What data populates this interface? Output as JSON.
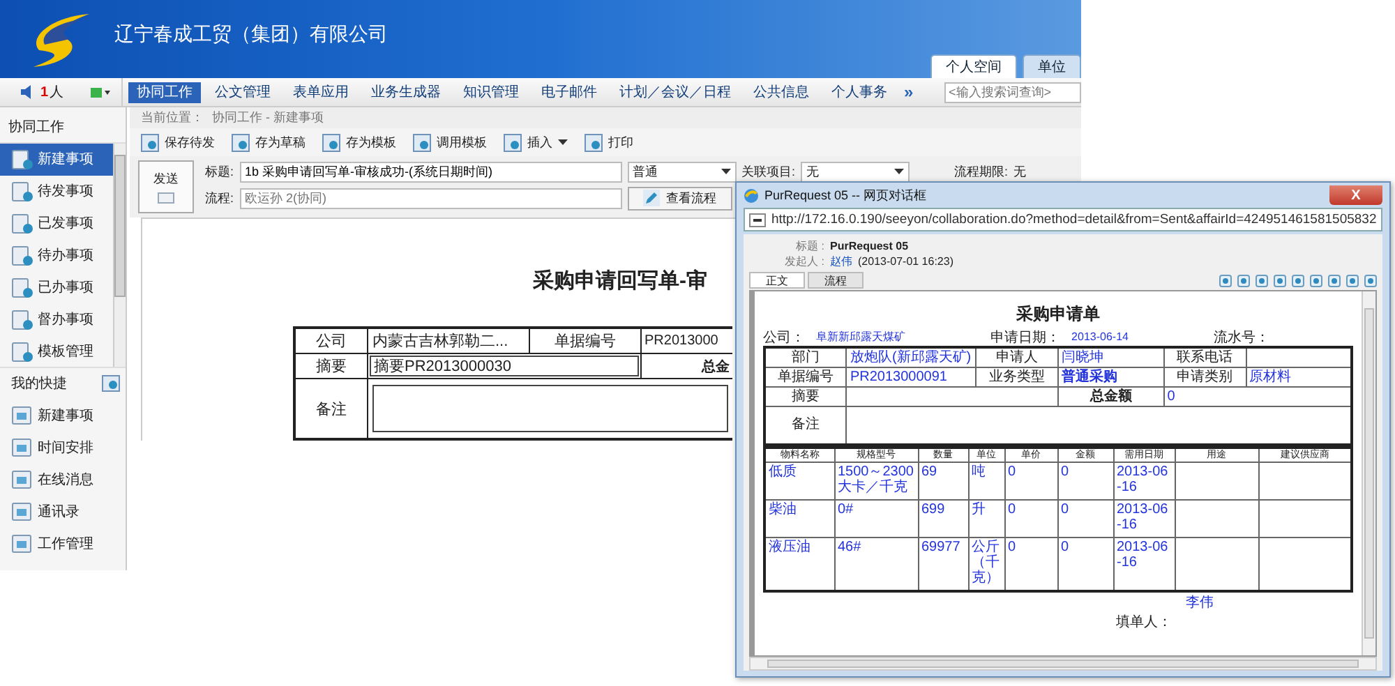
{
  "header": {
    "company": "辽宁春成工贸（集团）有限公司",
    "tabs": [
      {
        "label": "个人空间",
        "selected": true
      },
      {
        "label": "单位",
        "selected": false
      }
    ]
  },
  "nav": {
    "online_count": "1",
    "online_unit": "人",
    "more": "»",
    "search": {
      "placeholder": "<输入搜索词查询>"
    },
    "items": [
      {
        "label": "协同工作",
        "selected": true
      },
      {
        "label": "公文管理",
        "selected": false
      },
      {
        "label": "表单应用",
        "selected": false
      },
      {
        "label": "业务生成器",
        "selected": false
      },
      {
        "label": "知识管理",
        "selected": false
      },
      {
        "label": "电子邮件",
        "selected": false
      },
      {
        "label": "计划／会议／日程",
        "selected": false
      },
      {
        "label": "公共信息",
        "selected": false
      },
      {
        "label": "个人事务",
        "selected": false
      }
    ]
  },
  "sidebar": {
    "title": "协同工作",
    "shortcuts_title": "我的快捷",
    "items": [
      {
        "label": "新建事项",
        "selected": true
      },
      {
        "label": "待发事项",
        "selected": false
      },
      {
        "label": "已发事项",
        "selected": false
      },
      {
        "label": "待办事项",
        "selected": false
      },
      {
        "label": "已办事项",
        "selected": false
      },
      {
        "label": "督办事项",
        "selected": false
      },
      {
        "label": "模板管理",
        "selected": false
      }
    ],
    "shortcuts": [
      "新建事项",
      "时间安排",
      "在线消息",
      "通讯录",
      "工作管理"
    ]
  },
  "breadcrumb": {
    "label": "当前位置：",
    "path": "协同工作 - 新建事项"
  },
  "toolbar": [
    {
      "label": "保存待发",
      "dropdown": false
    },
    {
      "label": "存为草稿",
      "dropdown": false
    },
    {
      "label": "存为模板",
      "dropdown": false
    },
    {
      "label": "调用模板",
      "dropdown": false
    },
    {
      "label": "插入",
      "dropdown": true
    },
    {
      "label": "打印",
      "dropdown": false
    }
  ],
  "compose": {
    "send": "发送",
    "subject_label": "标题:",
    "subject": "1b 采购申请回写单-审核成功-(系统日期时间)",
    "priority": "普通",
    "related_label": "关联项目:",
    "related": "无",
    "deadline_label": "流程期限:",
    "deadline": "无",
    "flow_label": "流程:",
    "flow_placeholder": "欧运孙 2(协同)",
    "view_flow": "查看流程"
  },
  "document": {
    "title": "采购申请回写单-审",
    "company_label": "公司",
    "company": "内蒙古吉林郭勒二...",
    "number_label": "单据编号",
    "number": "PR2013000",
    "summary_label": "摘要",
    "summary": "摘要PR2013000030",
    "total_label": "总金",
    "remark_label": "备注"
  },
  "dialog": {
    "title": "PurRequest 05 -- 网页对话框",
    "close": "X",
    "url": "http://172.16.0.190/seeyon/collaboration.do?method=detail&from=Sent&affairId=424951461581505832",
    "subject_label": "标题 :",
    "subject": "PurRequest 05",
    "sender_label": "发起人 :",
    "sender": "赵伟",
    "sent_time": "(2013-07-01 16:23)",
    "tabs": [
      {
        "label": "正文",
        "selected": true
      },
      {
        "label": "流程",
        "selected": false
      }
    ],
    "form": {
      "title": "采购申请单",
      "company_label": "公司：",
      "company": "阜新新邱露天煤矿",
      "date_label": "申请日期：",
      "date": "2013-06-14",
      "serial_label": "流水号：",
      "dept_label": "部门",
      "dept": "放炮队(新邱露天矿)",
      "applicant_label": "申请人",
      "applicant": "闫晓坤",
      "phone_label": "联系电话",
      "number_label": "单据编号",
      "number": "PR2013000091",
      "biz_type_label": "业务类型",
      "biz_type": "普通采购",
      "category_label": "申请类别",
      "category": "原材料",
      "summary_label": "摘要",
      "total_label": "总金额",
      "total": "0",
      "remark_label": "备注",
      "columns": [
        "物料名称",
        "规格型号",
        "数量",
        "单位",
        "单价",
        "金额",
        "需用日期",
        "用途",
        "建议供应商"
      ],
      "rows": [
        [
          "低质",
          "1500～2300大卡／千克",
          "69",
          "吨",
          "0",
          "0",
          "2013-06-16",
          "",
          ""
        ],
        [
          "柴油",
          "0#",
          "699",
          "升",
          "0",
          "0",
          "2013-06-16",
          "",
          ""
        ],
        [
          "液压油",
          "46#",
          "69977",
          "公斤（千克）",
          "0",
          "0",
          "2013-06-16",
          "",
          ""
        ]
      ],
      "filler_label": "填单人：",
      "filler": "李伟"
    }
  }
}
